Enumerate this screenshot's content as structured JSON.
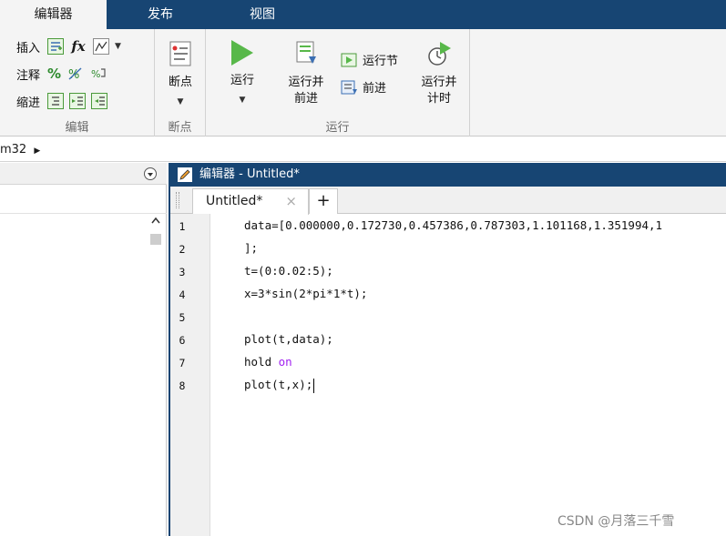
{
  "tabs": [
    {
      "label": "编辑器",
      "active": true
    },
    {
      "label": "发布",
      "active": false
    },
    {
      "label": "视图",
      "active": false
    }
  ],
  "ribbon": {
    "edit_group": {
      "insert_label": "插入",
      "fx_label": "fx",
      "comment_label": "注释",
      "comment_symbol": "%",
      "indent_label": "缩进",
      "group_label": "编辑"
    },
    "breakpoint_group": {
      "button_label": "断点",
      "group_label": "断点"
    },
    "run_group": {
      "run_label": "运行",
      "run_advance_line1": "运行并",
      "run_advance_line2": "前进",
      "run_section_label": "运行节",
      "advance_label": "前进",
      "run_time_line1": "运行并",
      "run_time_line2": "计时",
      "group_label": "运行"
    }
  },
  "breadcrumb": "m32",
  "editor": {
    "title": "编辑器 - Untitled*",
    "tab_label": "Untitled*",
    "tab_close": "×",
    "add_tab": "+",
    "lines": [
      {
        "num": "1",
        "code": "data=[0.000000,0.172730,0.457386,0.787303,1.101168,1.351994,1"
      },
      {
        "num": "2",
        "code": "];"
      },
      {
        "num": "3",
        "code": "t=(0:0.02:5);"
      },
      {
        "num": "4",
        "code": "x=3*sin(2*pi*1*t);"
      },
      {
        "num": "5",
        "code": ""
      },
      {
        "num": "6",
        "code": "plot(t,data);"
      },
      {
        "num": "7",
        "code_before": "hold ",
        "code_kw": "on"
      },
      {
        "num": "8",
        "code": "plot(t,x);"
      }
    ]
  },
  "watermark": "CSDN @月落三千雪",
  "colors": {
    "accent": "#174573",
    "run_green": "#58b84a",
    "keyword": "#a020f0"
  }
}
